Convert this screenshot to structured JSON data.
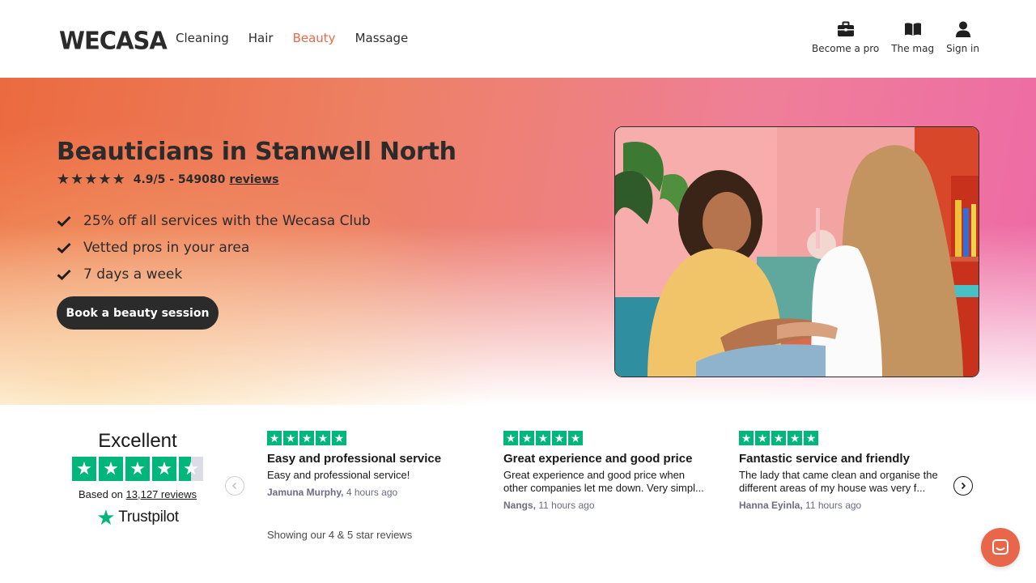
{
  "header": {
    "logo": "WECASA",
    "nav": [
      {
        "label": "Cleaning",
        "active": false
      },
      {
        "label": "Hair",
        "active": false
      },
      {
        "label": "Beauty",
        "active": true
      },
      {
        "label": "Massage",
        "active": false
      }
    ],
    "actions": [
      {
        "label": "Become a pro",
        "icon": "briefcase-icon"
      },
      {
        "label": "The mag",
        "icon": "book-icon"
      },
      {
        "label": "Sign in",
        "icon": "user-icon"
      }
    ]
  },
  "hero": {
    "title": "Beauticians in Stanwell North",
    "rating_text": "4.9/5 - 549080",
    "reviews_link": "reviews",
    "star_count": 5,
    "benefits": [
      "25% off all services with the Wecasa Club",
      "Vetted pros in your area",
      "7 days a week"
    ],
    "cta_label": "Book a beauty session",
    "image_icon": "beauty-session-photo"
  },
  "trustpilot": {
    "rating_label": "Excellent",
    "stars_rating": 4.5,
    "based_on_prefix": "Based on",
    "review_count_link": "13,127 reviews",
    "brand": "Trustpilot",
    "showing_text": "Showing our 4 & 5 star reviews"
  },
  "reviews": [
    {
      "title": "Easy and professional service",
      "body_lines": [
        "Easy and professional service!"
      ],
      "author": "Jamuna Murphy,",
      "time": "4 hours ago"
    },
    {
      "title": "Great experience and good price",
      "body_lines": [
        "Great experience and good price when",
        "other companies let me down. Very simpl..."
      ],
      "author": "Nangs,",
      "time": "11 hours ago"
    },
    {
      "title": "Fantastic service and friendly",
      "body_lines": [
        "The lady that came clean and organise the",
        "different areas of my house was very f..."
      ],
      "author": "Hanna Eyinla,",
      "time": "11 hours ago"
    }
  ],
  "colors": {
    "accent": "#e86a45",
    "dark": "#2b2b2b",
    "trustpilot_green": "#00b67a"
  }
}
